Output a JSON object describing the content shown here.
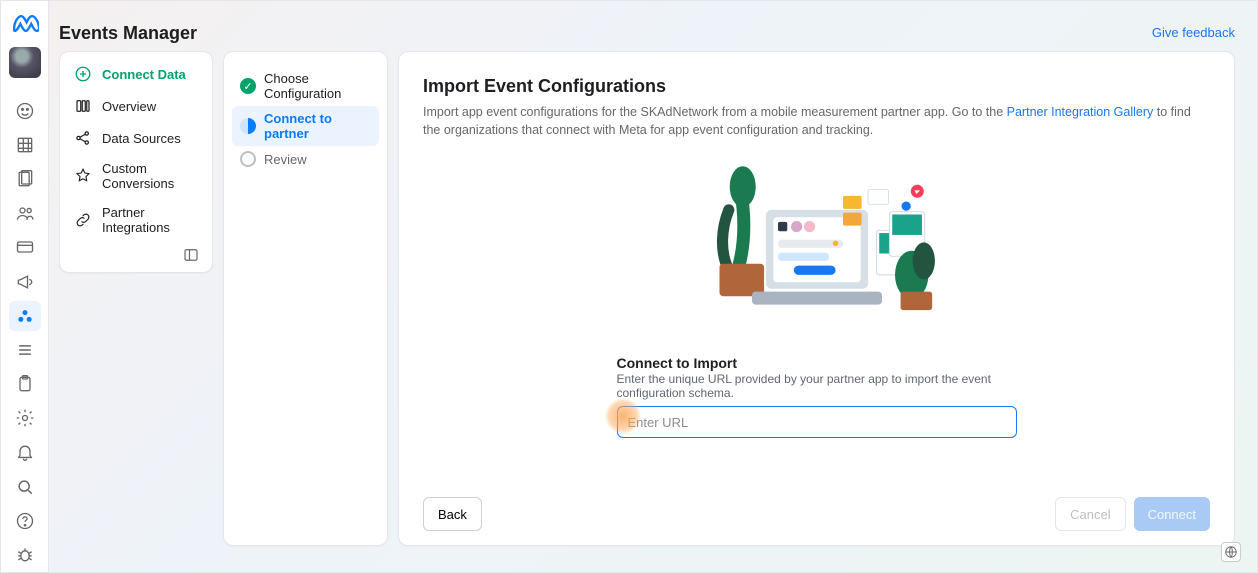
{
  "header": {
    "title": "Events Manager",
    "feedback": "Give feedback"
  },
  "sidenav": {
    "items": [
      {
        "label": "Connect Data",
        "icon": "plus-circle-icon",
        "active": true
      },
      {
        "label": "Overview",
        "icon": "columns-icon"
      },
      {
        "label": "Data Sources",
        "icon": "share-nodes-icon"
      },
      {
        "label": "Custom Conversions",
        "icon": "star-gear-icon"
      },
      {
        "label": "Partner Integrations",
        "icon": "link-icon"
      }
    ]
  },
  "stepper": {
    "steps": [
      {
        "label": "Choose Configuration",
        "state": "done"
      },
      {
        "label": "Connect to partner",
        "state": "active"
      },
      {
        "label": "Review",
        "state": "pending"
      }
    ]
  },
  "main": {
    "title": "Import Event Configurations",
    "desc_1": "Import app event configurations for the SKAdNetwork from a mobile measurement partner app. Go to the ",
    "link": "Partner Integration Gallery",
    "desc_2": " to find the organizations that connect with Meta for app event configuration and tracking.",
    "connect": {
      "heading": "Connect to Import",
      "sub": "Enter the unique URL provided by your partner app to import the event configuration schema.",
      "placeholder": "Enter URL",
      "value": ""
    },
    "footer": {
      "back": "Back",
      "cancel": "Cancel",
      "connect": "Connect"
    }
  }
}
